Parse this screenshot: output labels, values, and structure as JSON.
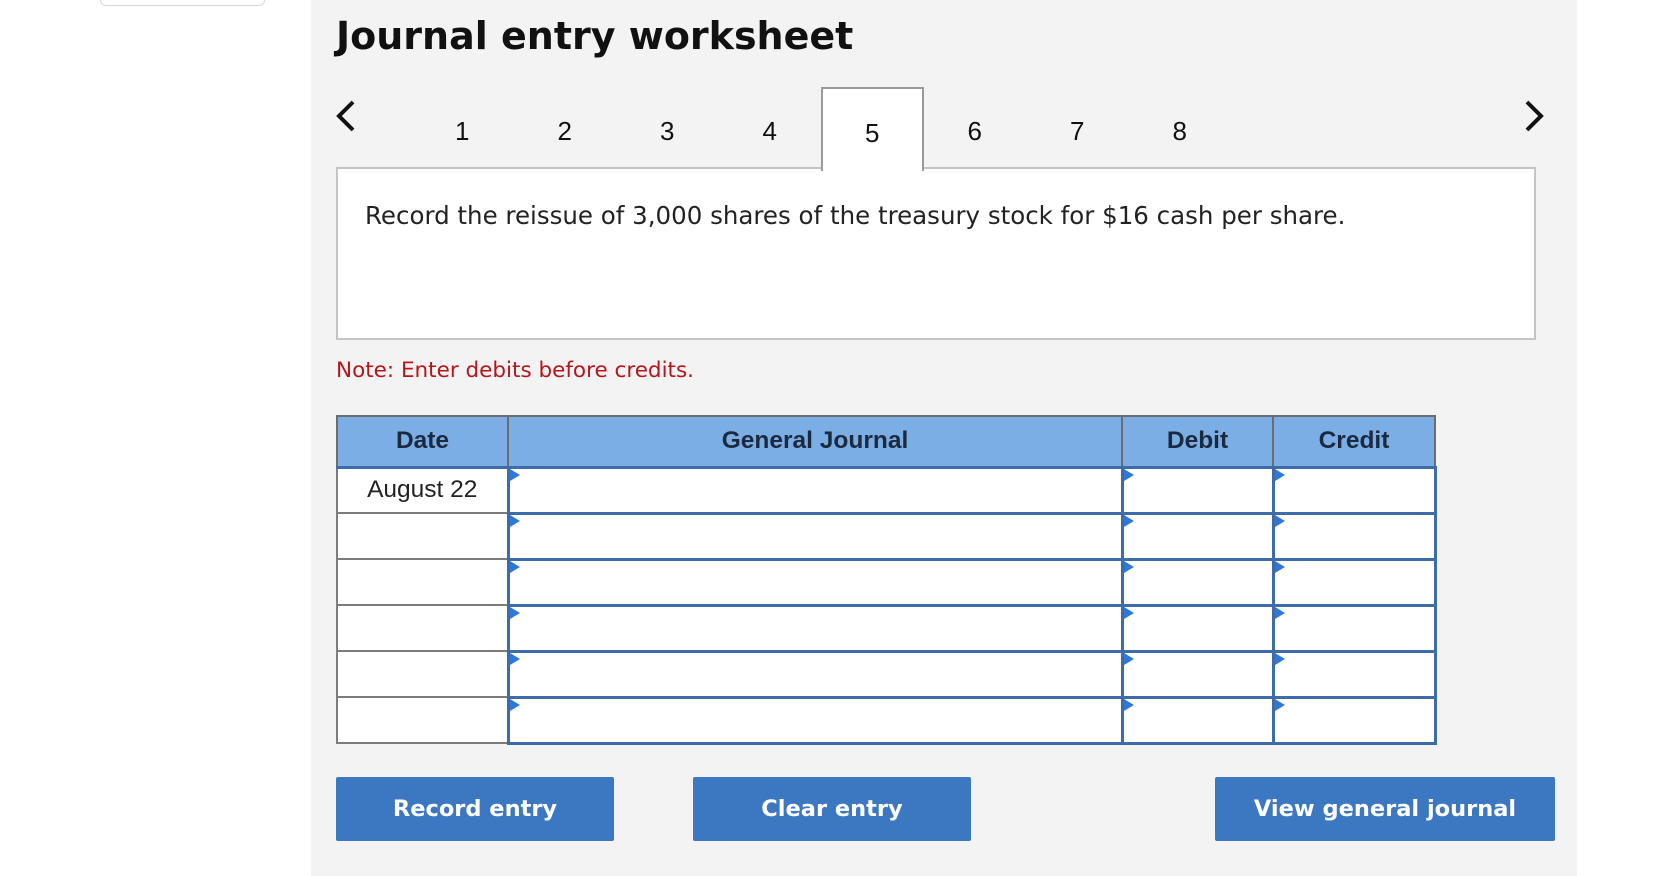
{
  "worksheet": {
    "title": "Journal entry worksheet",
    "nav": {
      "prev": "<",
      "next": ">"
    },
    "tabs": [
      "1",
      "2",
      "3",
      "4",
      "5",
      "6",
      "7",
      "8"
    ],
    "active_tab": "5",
    "prompt": "Record the reissue of 3,000 shares of the treasury stock for $16 cash per share.",
    "note": "Note: Enter debits before credits."
  },
  "journal": {
    "headers": {
      "date": "Date",
      "general_journal": "General Journal",
      "debit": "Debit",
      "credit": "Credit"
    },
    "rows": [
      {
        "date": "August 22",
        "account": "",
        "debit": "",
        "credit": ""
      },
      {
        "date": "",
        "account": "",
        "debit": "",
        "credit": ""
      },
      {
        "date": "",
        "account": "",
        "debit": "",
        "credit": ""
      },
      {
        "date": "",
        "account": "",
        "debit": "",
        "credit": ""
      },
      {
        "date": "",
        "account": "",
        "debit": "",
        "credit": ""
      },
      {
        "date": "",
        "account": "",
        "debit": "",
        "credit": ""
      }
    ]
  },
  "buttons": {
    "record": "Record entry",
    "clear": "Clear entry",
    "view": "View general journal"
  },
  "colors": {
    "header_bg": "#7aaee5",
    "button_bg": "#3c78c2",
    "note_text": "#b3171c",
    "input_border": "#3e6ca9"
  },
  "icons": {
    "prev": "chevron-left-icon",
    "next": "chevron-right-icon"
  }
}
